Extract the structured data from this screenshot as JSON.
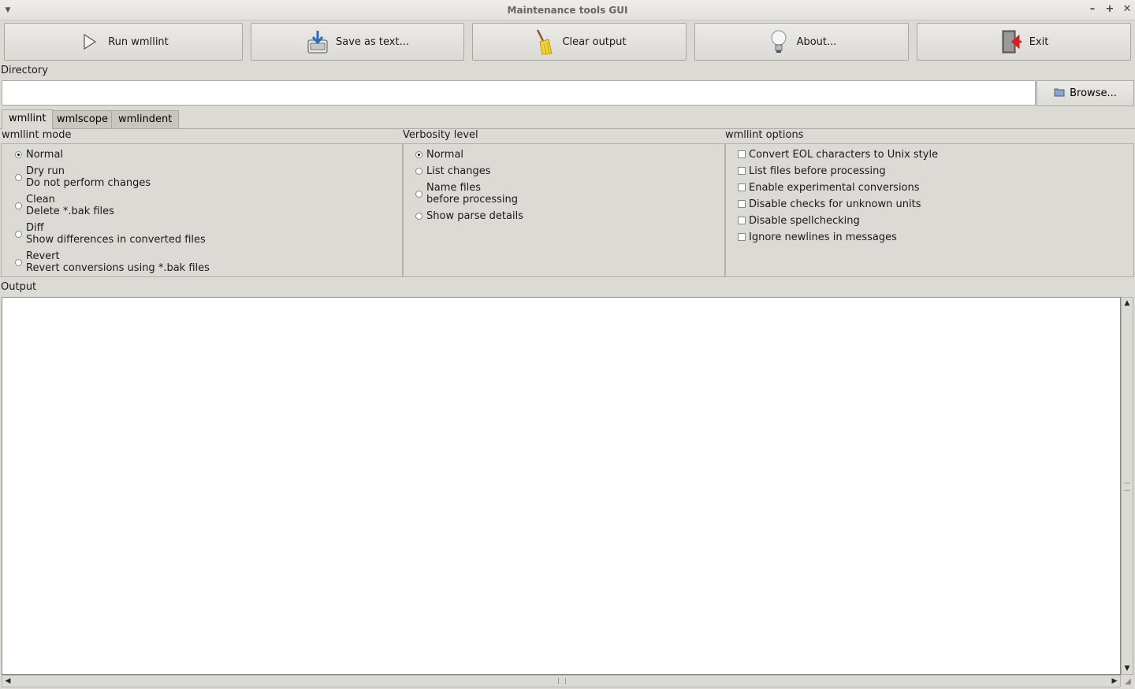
{
  "window": {
    "title": "Maintenance tools GUI"
  },
  "toolbar": {
    "run_label": "Run wmllint",
    "save_label": "Save as text...",
    "clear_label": "Clear output",
    "about_label": "About...",
    "exit_label": "Exit"
  },
  "directory": {
    "label": "Directory",
    "value": "",
    "browse_label": "Browse..."
  },
  "tabs": [
    {
      "label": "wmllint",
      "active": true
    },
    {
      "label": "wmlscope",
      "active": false
    },
    {
      "label": "wmlindent",
      "active": false
    }
  ],
  "mode": {
    "title": "wmllint mode",
    "options": [
      {
        "line1": "Normal",
        "line2": "",
        "selected": true
      },
      {
        "line1": "Dry run",
        "line2": "Do not perform changes",
        "selected": false
      },
      {
        "line1": "Clean",
        "line2": "Delete *.bak files",
        "selected": false
      },
      {
        "line1": "Diff",
        "line2": "Show differences in converted files",
        "selected": false
      },
      {
        "line1": "Revert",
        "line2": "Revert conversions using *.bak files",
        "selected": false
      }
    ]
  },
  "verbosity": {
    "title": "Verbosity level",
    "options": [
      {
        "line1": "Normal",
        "line2": "",
        "selected": true
      },
      {
        "line1": "List changes",
        "line2": "",
        "selected": false
      },
      {
        "line1": "Name files",
        "line2": "before processing",
        "selected": false
      },
      {
        "line1": "Show parse details",
        "line2": "",
        "selected": false
      }
    ]
  },
  "options": {
    "title": "wmllint options",
    "items": [
      {
        "label": "Convert EOL characters to Unix style",
        "checked": false
      },
      {
        "label": "List files before processing",
        "checked": false
      },
      {
        "label": "Enable experimental conversions",
        "checked": false
      },
      {
        "label": "Disable checks for unknown units",
        "checked": false
      },
      {
        "label": "Disable spellchecking",
        "checked": false
      },
      {
        "label": "Ignore newlines in messages",
        "checked": false
      }
    ]
  },
  "output": {
    "label": "Output",
    "text": ""
  }
}
